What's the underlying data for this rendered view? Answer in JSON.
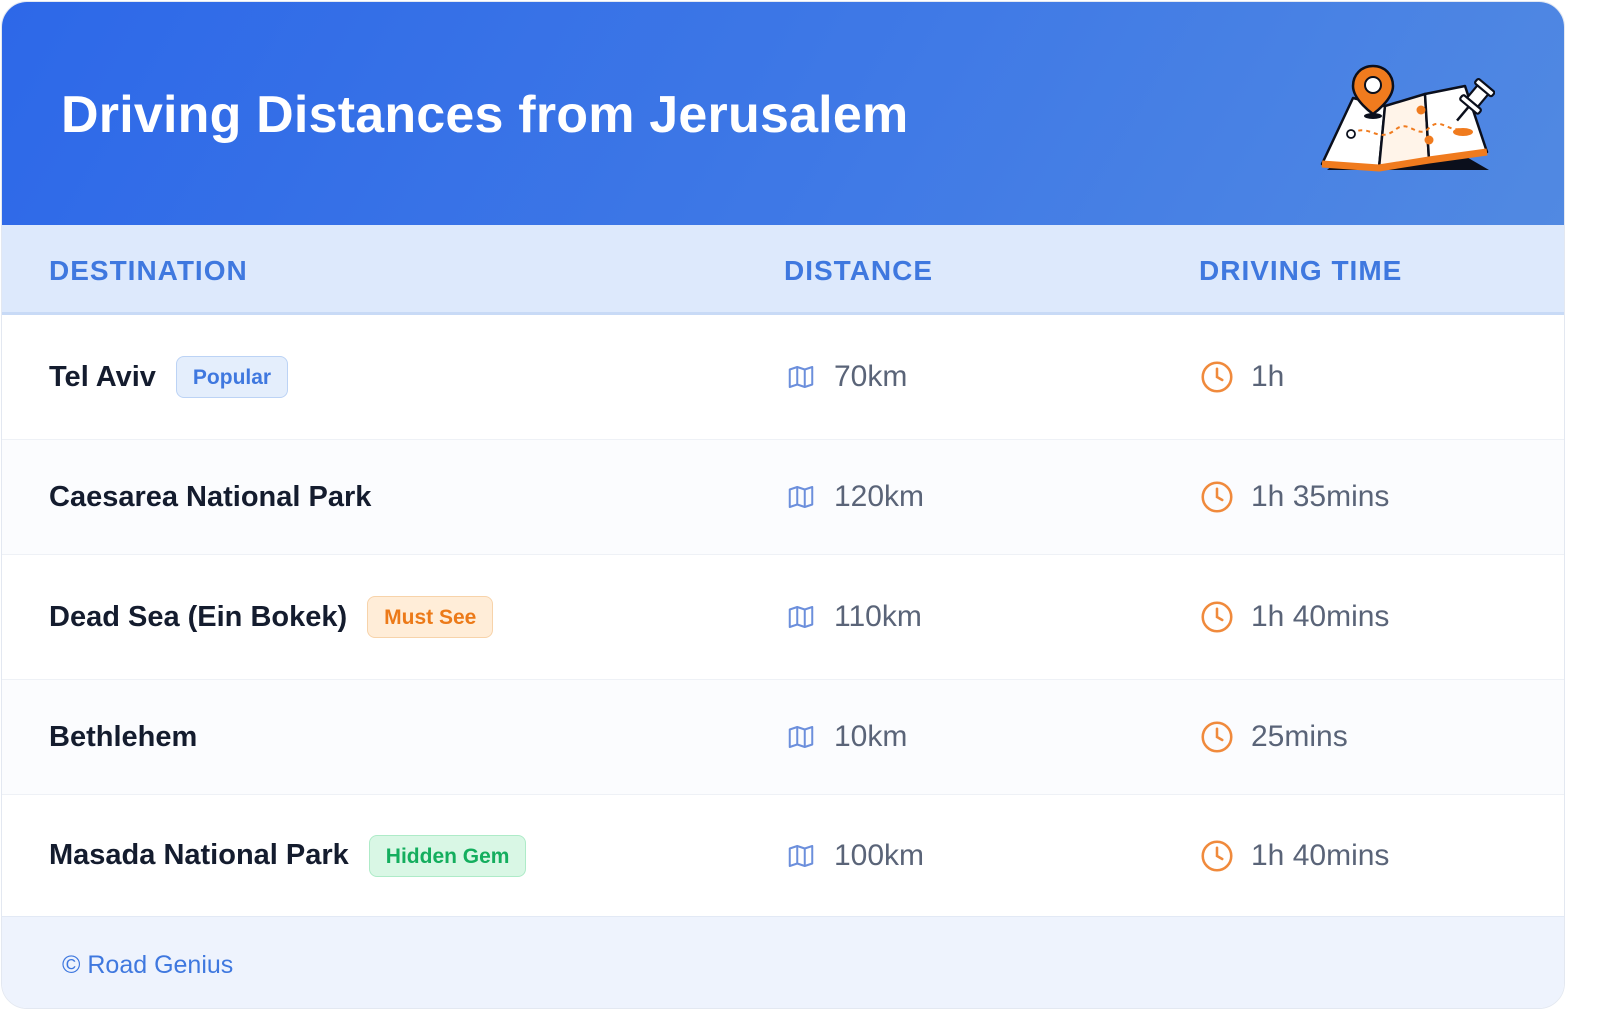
{
  "header": {
    "title": "Driving Distances from Jerusalem",
    "illustration": "folded-map-with-pins-icon"
  },
  "table": {
    "columns": [
      "DESTINATION",
      "DISTANCE",
      "DRIVING TIME"
    ],
    "rows": [
      {
        "destination": "Tel Aviv",
        "badge": "Popular",
        "badge_style": "blue",
        "distance": "70km",
        "time": "1h"
      },
      {
        "destination": "Caesarea National Park",
        "badge": "",
        "badge_style": "",
        "distance": "120km",
        "time": "1h 35mins"
      },
      {
        "destination": "Dead Sea (Ein Bokek)",
        "badge": "Must See",
        "badge_style": "orange",
        "distance": "110km",
        "time": "1h 40mins"
      },
      {
        "destination": "Bethlehem",
        "badge": "",
        "badge_style": "",
        "distance": "10km",
        "time": "25mins"
      },
      {
        "destination": "Masada National Park",
        "badge": "Hidden Gem",
        "badge_style": "green",
        "distance": "100km",
        "time": "1h 40mins"
      }
    ],
    "icons": {
      "distance": "map-icon",
      "time": "clock-icon"
    }
  },
  "footer": {
    "copyright": "© Road Genius"
  },
  "colors": {
    "header_start": "#2d68e8",
    "header_end": "#5189e2",
    "accent_blue": "#3f78df",
    "accent_orange": "#ec7a19",
    "accent_green": "#14ae5e"
  }
}
